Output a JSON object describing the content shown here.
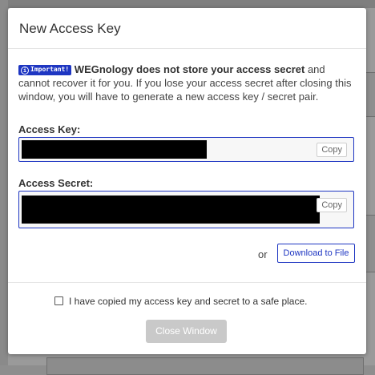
{
  "modal": {
    "title": "New Access Key",
    "notice": {
      "badge": "Important!",
      "badge_icon": "info-icon",
      "bold_text": "WEGnology does not store your access secret",
      "text": " and cannot recover it for you. If you lose your access secret after closing this window, you will have to generate a new access key / secret pair."
    },
    "access_key": {
      "label": "Access Key:",
      "value": "",
      "copy_label": "Copy"
    },
    "access_secret": {
      "label": "Access Secret:",
      "value": "",
      "copy_label": "Copy"
    },
    "or_text": "or",
    "download_label": "Download to File",
    "checkbox_label": "I have copied my access key and secret to a safe place.",
    "checkbox_checked": false,
    "close_label": "Close Window"
  },
  "colors": {
    "accent": "#1e36c2",
    "disabled_button": "#c9c9c9",
    "overlay": "#8e8e8e"
  }
}
